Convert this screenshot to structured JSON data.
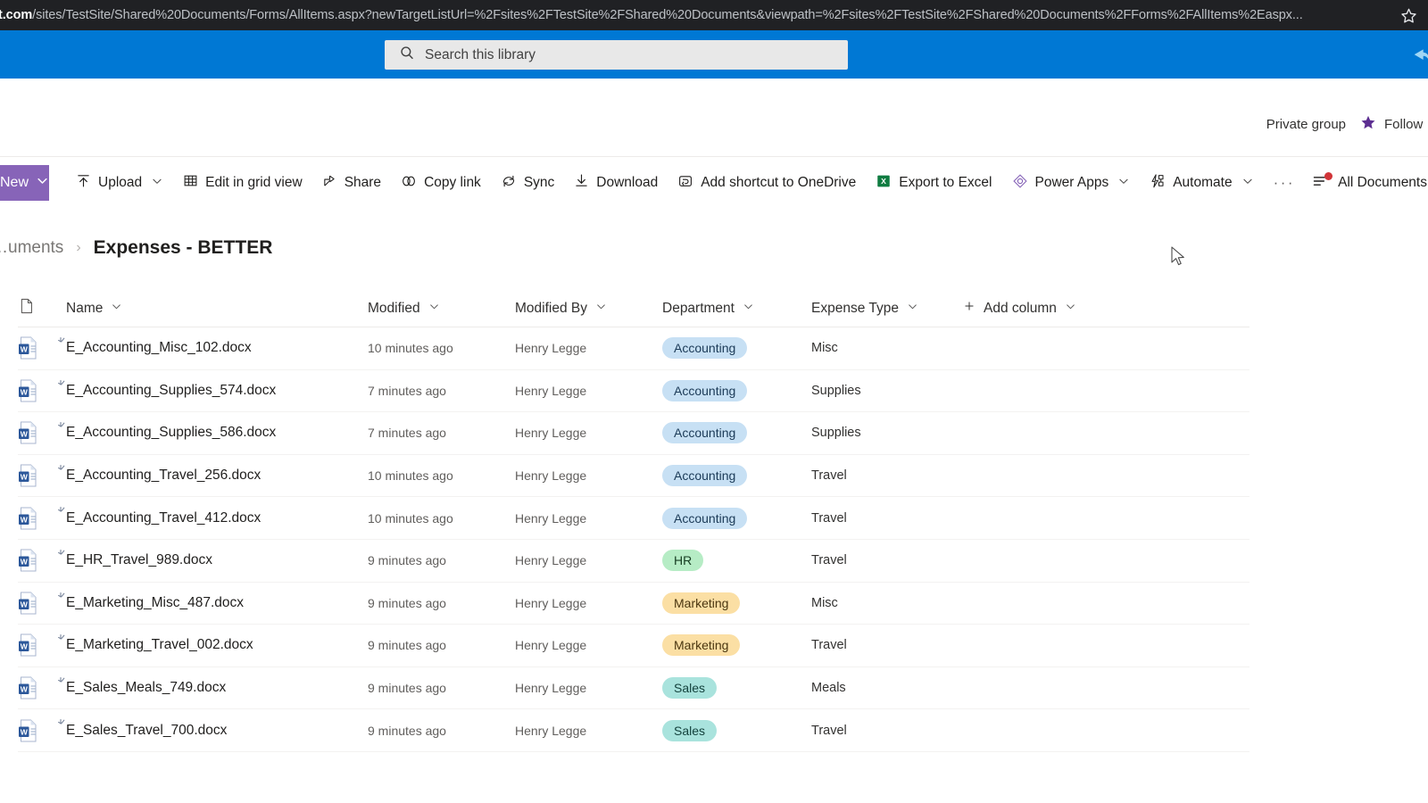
{
  "browser": {
    "url_host": "t.com",
    "url_path": "/sites/TestSite/Shared%20Documents/Forms/AllItems.aspx?newTargetListUrl=%2Fsites%2FTestSite%2FShared%20Documents&viewpath=%2Fsites%2FTestSite%2FShared%20Documents%2FForms%2FAllItems%2Easpx...",
    "bookmark_icon": "star-icon"
  },
  "suite": {
    "search_placeholder": "Search this library",
    "search_icon": "search-icon"
  },
  "site_header": {
    "privacy_label": "Private group",
    "follow_label": "Follow",
    "follow_icon": "star-filled-icon"
  },
  "command_bar": {
    "new_label": "New",
    "items": [
      {
        "label": "Upload",
        "icon": "upload-icon",
        "has_chevron": true
      },
      {
        "label": "Edit in grid view",
        "icon": "grid-icon",
        "has_chevron": false
      },
      {
        "label": "Share",
        "icon": "share-icon",
        "has_chevron": false
      },
      {
        "label": "Copy link",
        "icon": "link-icon",
        "has_chevron": false
      },
      {
        "label": "Sync",
        "icon": "sync-icon",
        "has_chevron": false
      },
      {
        "label": "Download",
        "icon": "download-icon",
        "has_chevron": false
      },
      {
        "label": "Add shortcut to OneDrive",
        "icon": "onedrive-shortcut-icon",
        "has_chevron": false
      },
      {
        "label": "Export to Excel",
        "icon": "excel-icon",
        "has_chevron": false
      },
      {
        "label": "Power Apps",
        "icon": "powerapps-icon",
        "has_chevron": true
      },
      {
        "label": "Automate",
        "icon": "automate-icon",
        "has_chevron": true
      }
    ],
    "overflow_label": "···",
    "view_label": "All Documents",
    "view_icon": "view-list-icon"
  },
  "breadcrumb": {
    "parent": "…uments",
    "separator": "›",
    "current": "Expenses - BETTER"
  },
  "table": {
    "columns": [
      {
        "key": "icon",
        "label": "",
        "icon": "file-type-icon",
        "has_chevron": false
      },
      {
        "key": "name",
        "label": "Name",
        "has_chevron": true
      },
      {
        "key": "modified",
        "label": "Modified",
        "has_chevron": true
      },
      {
        "key": "modified_by",
        "label": "Modified By",
        "has_chevron": true
      },
      {
        "key": "department",
        "label": "Department",
        "has_chevron": true
      },
      {
        "key": "expense_type",
        "label": "Expense Type",
        "has_chevron": true
      },
      {
        "key": "add_column",
        "label": "Add column",
        "has_chevron": true
      }
    ],
    "rows": [
      {
        "name": "E_Accounting_Misc_102.docx",
        "modified": "10 minutes ago",
        "modified_by": "Henry Legge",
        "department": "Accounting",
        "expense_type": "Misc"
      },
      {
        "name": "E_Accounting_Supplies_574.docx",
        "modified": "7 minutes ago",
        "modified_by": "Henry Legge",
        "department": "Accounting",
        "expense_type": "Supplies"
      },
      {
        "name": "E_Accounting_Supplies_586.docx",
        "modified": "7 minutes ago",
        "modified_by": "Henry Legge",
        "department": "Accounting",
        "expense_type": "Supplies"
      },
      {
        "name": "E_Accounting_Travel_256.docx",
        "modified": "10 minutes ago",
        "modified_by": "Henry Legge",
        "department": "Accounting",
        "expense_type": "Travel"
      },
      {
        "name": "E_Accounting_Travel_412.docx",
        "modified": "10 minutes ago",
        "modified_by": "Henry Legge",
        "department": "Accounting",
        "expense_type": "Travel"
      },
      {
        "name": "E_HR_Travel_989.docx",
        "modified": "9 minutes ago",
        "modified_by": "Henry Legge",
        "department": "HR",
        "expense_type": "Travel"
      },
      {
        "name": "E_Marketing_Misc_487.docx",
        "modified": "9 minutes ago",
        "modified_by": "Henry Legge",
        "department": "Marketing",
        "expense_type": "Misc"
      },
      {
        "name": "E_Marketing_Travel_002.docx",
        "modified": "9 minutes ago",
        "modified_by": "Henry Legge",
        "department": "Marketing",
        "expense_type": "Travel"
      },
      {
        "name": "E_Sales_Meals_749.docx",
        "modified": "9 minutes ago",
        "modified_by": "Henry Legge",
        "department": "Sales",
        "expense_type": "Meals"
      },
      {
        "name": "E_Sales_Travel_700.docx",
        "modified": "9 minutes ago",
        "modified_by": "Henry Legge",
        "department": "Sales",
        "expense_type": "Travel"
      }
    ]
  },
  "colors": {
    "suite_bar": "#0078d4",
    "new_button": "#8764b8",
    "follow_star": "#5c2e91",
    "excel_green": "#107c41",
    "word_blue": "#2b579a",
    "notification_dot": "#d13438",
    "pill_accounting_bg": "#c7e0f4",
    "pill_accounting_text": "#1b3a57",
    "pill_hr_bg": "#b6ecc5",
    "pill_hr_text": "#173d22",
    "pill_marketing_bg": "#fbdfa4",
    "pill_marketing_text": "#4a3610",
    "pill_sales_bg": "#a9e3dd",
    "pill_sales_text": "#14423d"
  }
}
